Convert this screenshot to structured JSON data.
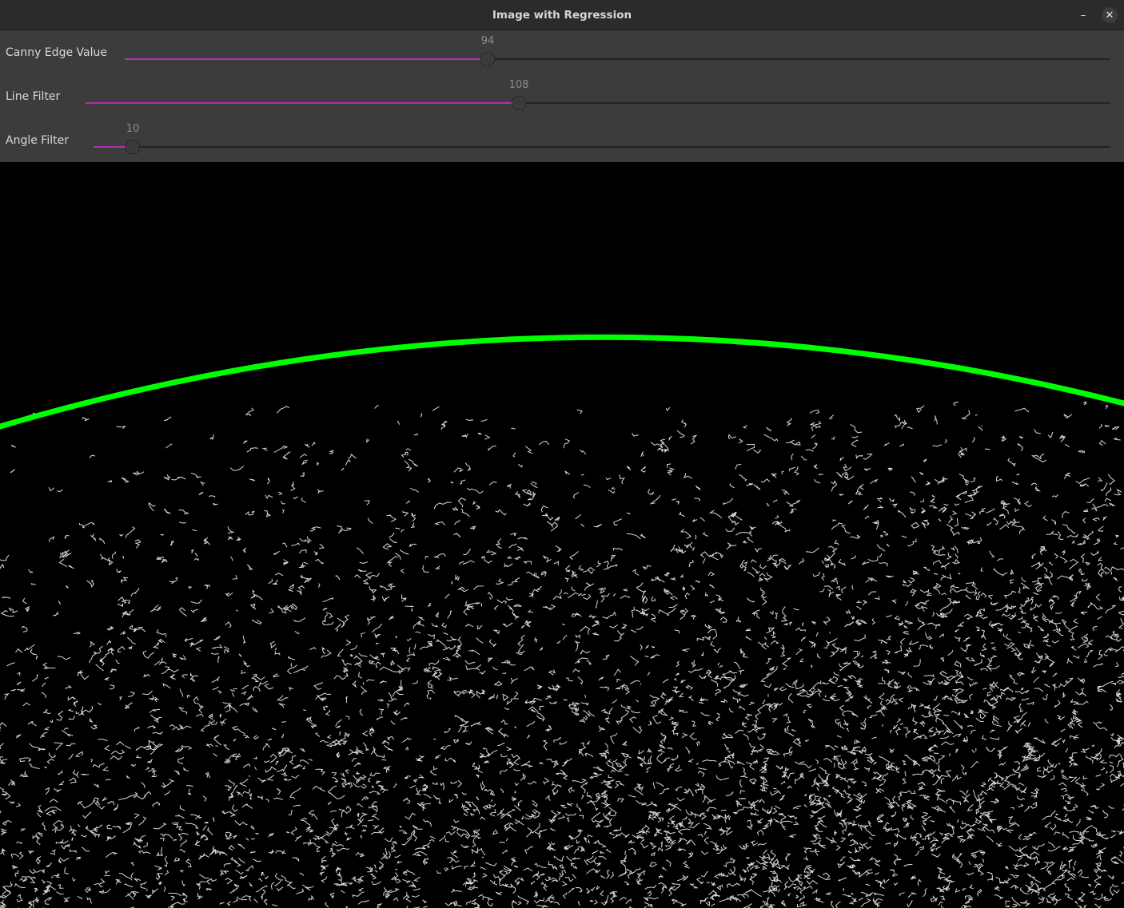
{
  "window": {
    "title": "Image with Regression",
    "minimize_icon": "minimize-icon",
    "close_icon": "close-icon"
  },
  "trackbars": [
    {
      "label": "Canny Edge Value",
      "value": "94",
      "fraction": 0.3677
    },
    {
      "label": "Line Filter",
      "value": "108",
      "fraction": 0.4396
    },
    {
      "label": "Angle Filter",
      "value": "10",
      "fraction": 0.0391
    }
  ],
  "colors": {
    "fill": "#b230b2",
    "regression_line": "#00ff00",
    "edges": "#ffffff"
  }
}
